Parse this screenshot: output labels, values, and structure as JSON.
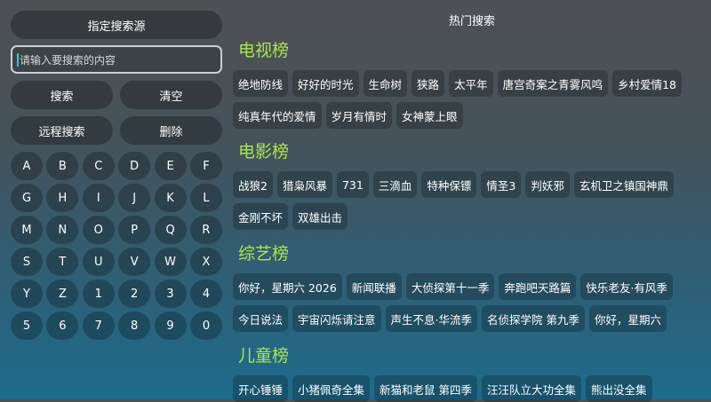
{
  "left": {
    "source_button": "指定搜索源",
    "search_placeholder": "请输入要搜索的内容",
    "search_button": "搜索",
    "clear_button": "清空",
    "remote_search_button": "远程搜索",
    "delete_button": "删除",
    "keys": [
      "A",
      "B",
      "C",
      "D",
      "E",
      "F",
      "G",
      "H",
      "I",
      "J",
      "K",
      "L",
      "M",
      "N",
      "O",
      "P",
      "Q",
      "R",
      "S",
      "T",
      "U",
      "V",
      "W",
      "X",
      "Y",
      "Z",
      "1",
      "2",
      "3",
      "4",
      "5",
      "6",
      "7",
      "8",
      "9",
      "0"
    ]
  },
  "right": {
    "title": "热门搜索",
    "sections": [
      {
        "title": "电视榜",
        "items": [
          "绝地防线",
          "好好的时光",
          "生命树",
          "狭路",
          "太平年",
          "唐宫奇案之青雾风鸣",
          "乡村爱情18",
          "纯真年代的爱情",
          "岁月有情时",
          "女神蒙上眼"
        ]
      },
      {
        "title": "电影榜",
        "items": [
          "战狼2",
          "猎枭风暴",
          "731",
          "三滴血",
          "特种保镖",
          "情圣3",
          "判妖邪",
          "玄机卫之镇国神鼎",
          "金刚不坏",
          "双雄出击"
        ]
      },
      {
        "title": "综艺榜",
        "items": [
          "你好，星期六 2026",
          "新闻联播",
          "大侦探第十一季",
          "奔跑吧天路篇",
          "快乐老友·有风季",
          "今日说法",
          "宇宙闪烁请注意",
          "声生不息·华流季",
          "名侦探学院 第九季",
          "你好，星期六"
        ]
      },
      {
        "title": "儿童榜",
        "items": [
          "开心锤锤",
          "小猪佩奇全集",
          "新猫和老鼠 第四季",
          "汪汪队立大功全集",
          "熊出没全集"
        ]
      }
    ]
  }
}
